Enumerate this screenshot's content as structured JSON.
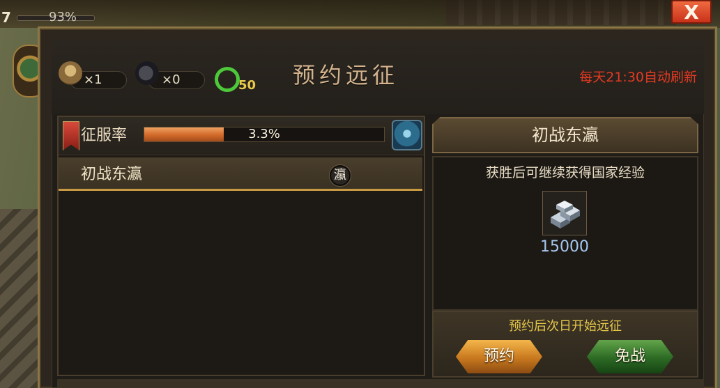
{
  "hud": {
    "level": "7",
    "exp_percent_text": "93%",
    "close_label": "X"
  },
  "resources": [
    {
      "name": "gold-bag",
      "value": "×1"
    },
    {
      "name": "bomb",
      "value": "×0"
    },
    {
      "name": "q-medal",
      "value": "50"
    }
  ],
  "dialog": {
    "title": "预约远征",
    "refresh_note": "每天21:30自动刷新"
  },
  "conquest": {
    "label": "征服率",
    "percent_text": "3.3%",
    "progress": 0.33
  },
  "list": {
    "items": [
      {
        "label": "初战东瀛",
        "badge": "瀛"
      }
    ]
  },
  "detail": {
    "title": "初战东瀛",
    "victory_text": "获胜后可继续获得国家经验",
    "reward_amount": "15000",
    "start_note": "预约后次日开始远征",
    "reserve_button": "预约",
    "avoid_button": "免战"
  },
  "colors": {
    "accent_gold": "#c89a44",
    "refresh_red": "#e33a22",
    "note_yellow": "#e6c84a",
    "reward_blue": "#a8c8f0"
  }
}
